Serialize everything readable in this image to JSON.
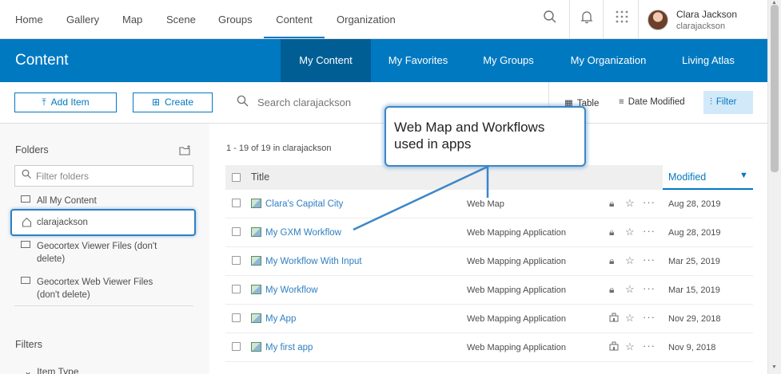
{
  "top_nav": {
    "items": [
      {
        "label": "Home",
        "active": false
      },
      {
        "label": "Gallery",
        "active": false
      },
      {
        "label": "Map",
        "active": false
      },
      {
        "label": "Scene",
        "active": false
      },
      {
        "label": "Groups",
        "active": false
      },
      {
        "label": "Content",
        "active": true
      },
      {
        "label": "Organization",
        "active": false
      }
    ],
    "icons": [
      "search-icon",
      "bell-icon",
      "apps-grid-icon"
    ],
    "user": {
      "name": "Clara Jackson",
      "username": "clarajackson"
    }
  },
  "content_header": {
    "title": "Content",
    "tabs": [
      {
        "label": "My Content",
        "active": true
      },
      {
        "label": "My Favorites",
        "active": false
      },
      {
        "label": "My Groups",
        "active": false
      },
      {
        "label": "My Organization",
        "active": false
      },
      {
        "label": "Living Atlas",
        "active": false
      }
    ],
    "accent_color": "#0079c1",
    "active_tab_color": "#005e95"
  },
  "toolbar": {
    "add_item_label": "Add Item",
    "create_label": "Create",
    "search_placeholder": "Search clarajackson",
    "table_label": "Table",
    "sort_label": "Date Modified",
    "filter_label": "Filter"
  },
  "sidebar": {
    "folders_heading": "Folders",
    "filter_placeholder": "Filter folders",
    "folders": [
      {
        "label": "All My Content",
        "selected": false
      },
      {
        "label": "clarajackson",
        "selected": true
      },
      {
        "label": "Geocortex Viewer Files (don't delete)",
        "selected": false
      },
      {
        "label": "Geocortex Web Viewer Files (don't delete)",
        "selected": false
      }
    ],
    "filters_heading": "Filters",
    "filter_group": "Item Type"
  },
  "list": {
    "count_text": "1 - 19 of 19 in clarajackson",
    "columns": {
      "title": "Title",
      "modified": "Modified"
    },
    "rows": [
      {
        "title": "Clara's Capital City",
        "type": "Web Map",
        "share_icon": "lock-icon",
        "date": "Aug 28, 2019"
      },
      {
        "title": "My GXM Workflow",
        "type": "Web Mapping Application",
        "share_icon": "lock-icon",
        "date": "Aug 28, 2019"
      },
      {
        "title": "My Workflow With Input",
        "type": "Web Mapping Application",
        "share_icon": "lock-icon",
        "date": "Mar 25, 2019"
      },
      {
        "title": "My Workflow",
        "type": "Web Mapping Application",
        "share_icon": "lock-icon",
        "date": "Mar 15, 2019"
      },
      {
        "title": "My App",
        "type": "Web Mapping Application",
        "share_icon": "organization-icon",
        "date": "Nov 29, 2018"
      },
      {
        "title": "My first app",
        "type": "Web Mapping Application",
        "share_icon": "organization-icon",
        "date": "Nov 9, 2018"
      }
    ]
  },
  "callout": {
    "text": "Web Map and Workflows used in apps",
    "border_color": "#3d86c6"
  }
}
